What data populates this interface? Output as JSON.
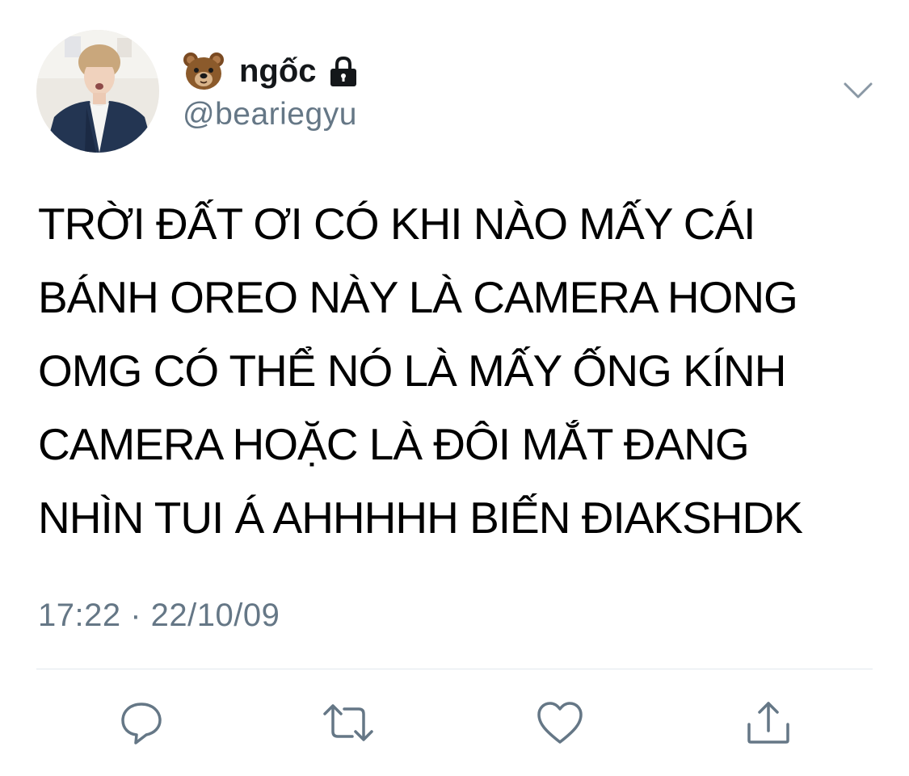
{
  "tweet": {
    "author": {
      "name_emoji": "bear-face-emoji",
      "display_name": "ngốc",
      "protected_icon": "lock-icon",
      "handle": "@beariegyu"
    },
    "menu_icon": "chevron-down-icon",
    "text": "TRỜI ĐẤT ƠI CÓ KHI NÀO MẤY CÁI\nBÁNH OREO NÀY LÀ CAMERA HONG\nOMG CÓ THỂ NÓ LÀ MẤY ỐNG KÍNH\nCAMERA HOẶC LÀ ĐÔI MẮT ĐANG\nNHÌN TUI Á AHHHHH BIẾN ĐIAKSHDK",
    "timestamp": "17:22 · 22/10/09",
    "actions": [
      {
        "name": "reply",
        "icon": "speech-bubble-icon"
      },
      {
        "name": "retweet",
        "icon": "retweet-arrows-icon"
      },
      {
        "name": "like",
        "icon": "heart-icon"
      },
      {
        "name": "share",
        "icon": "share-arrow-icon"
      }
    ]
  },
  "colors": {
    "text": "#000000",
    "secondary": "#657786",
    "icon": "#657786",
    "divider": "#e1e8ed",
    "background": "#ffffff"
  }
}
